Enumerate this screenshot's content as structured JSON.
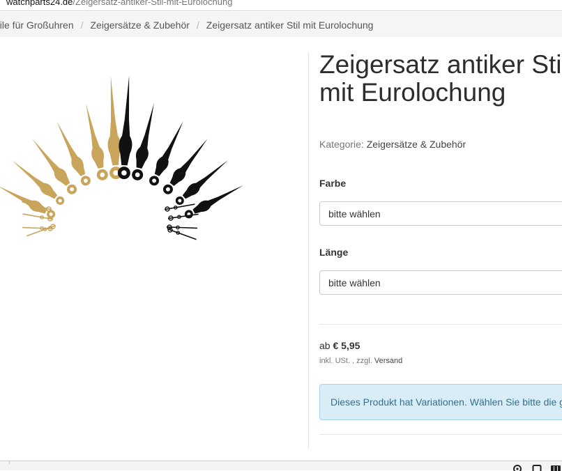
{
  "browser": {
    "host": "watchparts24.de",
    "path": "/Zeigersatz-antiker-Stil-mit-Eurolochung"
  },
  "breadcrumb": [
    "eile für Großuhren",
    "Zeigersätze & Zubehör",
    "Zeigersatz antiker Stil mit Eurolochung"
  ],
  "product": {
    "title": "Zeigersatz antiker Stil mit Eurolochung",
    "category_label": "Kategorie:",
    "category_value": "Zeigersätze & Zubehör",
    "image_alt": "product-image-clock-hands",
    "colors": {
      "gold": "#c8a55a",
      "black": "#111111"
    }
  },
  "options": {
    "color_label": "Farbe",
    "color_value": "bitte wählen",
    "length_label": "Länge",
    "length_value": "bitte wählen"
  },
  "pricing": {
    "prefix": "ab",
    "price": "€ 5,95",
    "tax_note": "inkl. USt. , zzgl.",
    "shipping_link": "Versand"
  },
  "alert": {
    "text": "Dieses Produkt hat Variationen. Wählen Sie bitte die g"
  },
  "statusbar": {
    "icons": [
      "settings-icon",
      "window-icon",
      "grid-icon"
    ]
  }
}
